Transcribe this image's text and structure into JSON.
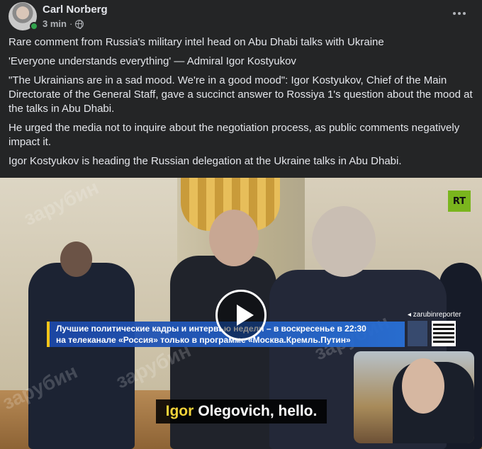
{
  "post": {
    "author": "Carl Norberg",
    "time": "3 min",
    "separator": "·",
    "privacy_icon": "globe-icon",
    "more_icon": "more-horizontal-icon"
  },
  "text": {
    "p1": "Rare comment from Russia's military intel head on Abu Dhabi talks with Ukraine",
    "p2": "'Everyone understands everything' — Admiral Igor Kostyukov",
    "p3": "\"The Ukrainians are in a sad mood. We're in a good mood\": Igor Kostyukov, Chief of the Main Directorate of the General Staff, gave a succinct answer to Rossiya 1's question about the mood at the talks in Abu Dhabi.",
    "p4": "He urged the media not to inquire about the negotiation process, as public comments negatively impact it.",
    "p5": "Igor Kostyukov is heading the Russian delegation at the Ukraine talks in Abu Dhabi."
  },
  "video": {
    "channel_logo": "RT",
    "banner_line1": "Лучшие политические кадры и интервью недели – в воскресенье в 22:30",
    "banner_line2": "на телеканале «Россия» только в программе «Москва.Кремль.Путин»",
    "qr_handle": "◂ zarubinreporter",
    "subtitle_highlight": "Igor",
    "subtitle_rest": "Olegovich, hello.",
    "watermark": "зарубин",
    "play_icon": "play-icon"
  },
  "colors": {
    "background": "#242526",
    "text": "#e4e6eb",
    "secondary": "#b0b3b8",
    "online": "#31a24c",
    "subtitle_highlight": "#f2d33a"
  }
}
